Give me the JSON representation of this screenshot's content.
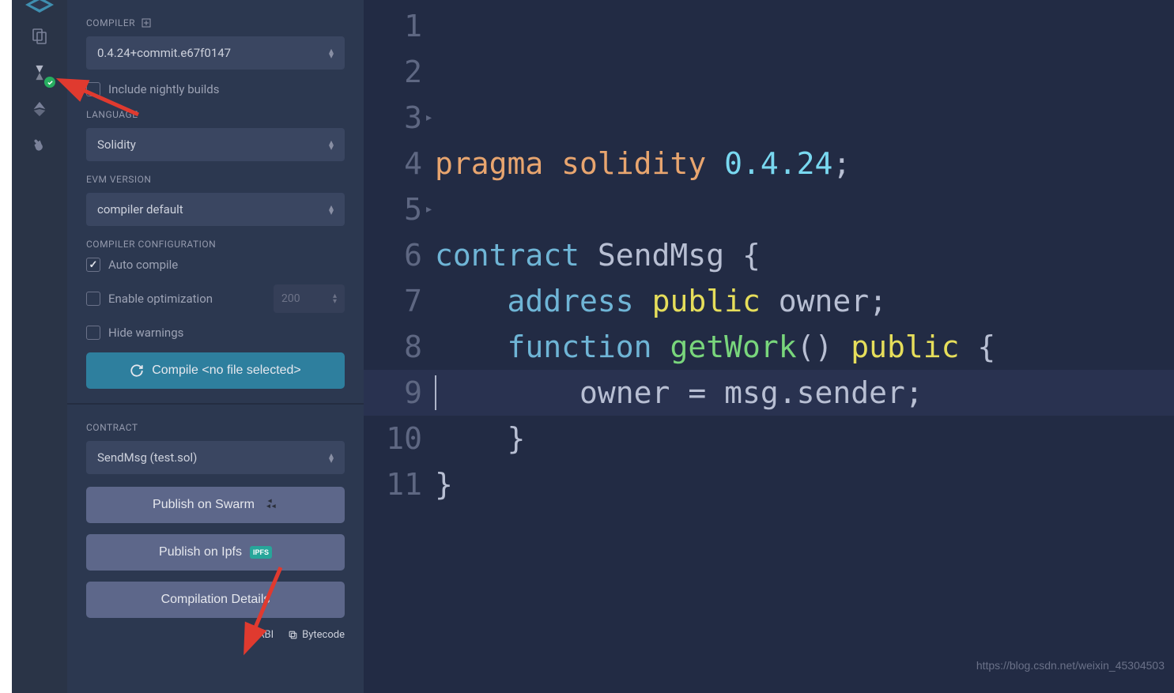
{
  "iconbar": {
    "icons": [
      "logo",
      "files",
      "solidity",
      "deploy",
      "plugin"
    ]
  },
  "compiler": {
    "label": "COMPILER",
    "version": "0.4.24+commit.e67f0147",
    "nightly_label": "Include nightly builds",
    "language_label": "LANGUAGE",
    "language": "Solidity",
    "evm_label": "EVM VERSION",
    "evm": "compiler default",
    "config_label": "COMPILER CONFIGURATION",
    "auto_compile": "Auto compile",
    "enable_opt": "Enable optimization",
    "opt_runs": "200",
    "hide_warnings": "Hide warnings",
    "compile_btn": "Compile <no file selected>"
  },
  "contract": {
    "label": "CONTRACT",
    "selected": "SendMsg (test.sol)",
    "publish_swarm": "Publish on Swarm",
    "publish_ipfs": "Publish on Ipfs",
    "details": "Compilation Details",
    "abi": "ABI",
    "bytecode": "Bytecode"
  },
  "editor": {
    "lines": [
      {
        "n": 1,
        "tokens": [
          [
            "kw-pragma",
            "pragma"
          ],
          [
            "",
            ""
          ],
          [
            "kw-pragma",
            "solidity"
          ],
          [
            "",
            ""
          ],
          [
            "ver",
            "0.4.24"
          ],
          [
            "punct",
            ";"
          ]
        ]
      },
      {
        "n": 2,
        "tokens": []
      },
      {
        "n": 3,
        "fold": true,
        "tokens": [
          [
            "kw-contract",
            "contract"
          ],
          [
            "",
            ""
          ],
          [
            "contract-name",
            "SendMsg"
          ],
          [
            "",
            ""
          ],
          [
            "punct",
            "{"
          ]
        ]
      },
      {
        "n": 4,
        "indent": 1,
        "tokens": [
          [
            "kw-type",
            "address"
          ],
          [
            "",
            ""
          ],
          [
            "kw-pub",
            "public"
          ],
          [
            "",
            ""
          ],
          [
            "ident",
            "owner"
          ],
          [
            "punct",
            ";"
          ]
        ]
      },
      {
        "n": 5,
        "indent": 1,
        "fold": true,
        "tokens": [
          [
            "kw-func",
            "function"
          ],
          [
            "",
            ""
          ],
          [
            "fn-name",
            "getWork"
          ],
          [
            "punct",
            "()"
          ],
          [
            "",
            ""
          ],
          [
            "kw-pub",
            "public"
          ],
          [
            "",
            ""
          ],
          [
            "punct",
            "{"
          ]
        ]
      },
      {
        "n": 6,
        "indent": 2,
        "tokens": [
          [
            "ident",
            "owner"
          ],
          [
            "",
            ""
          ],
          [
            "punct",
            "="
          ],
          [
            "",
            ""
          ],
          [
            "ident",
            "msg"
          ],
          [
            "punct",
            "."
          ],
          [
            "ident",
            "sender"
          ],
          [
            "punct",
            ";"
          ]
        ]
      },
      {
        "n": 7,
        "indent": 1,
        "tokens": [
          [
            "punct",
            "}"
          ]
        ]
      },
      {
        "n": 8,
        "tokens": [
          [
            "punct",
            "}"
          ]
        ]
      },
      {
        "n": 9,
        "tokens": []
      },
      {
        "n": 10,
        "tokens": []
      },
      {
        "n": 11,
        "tokens": []
      }
    ]
  },
  "watermark": "https://blog.csdn.net/weixin_45304503"
}
